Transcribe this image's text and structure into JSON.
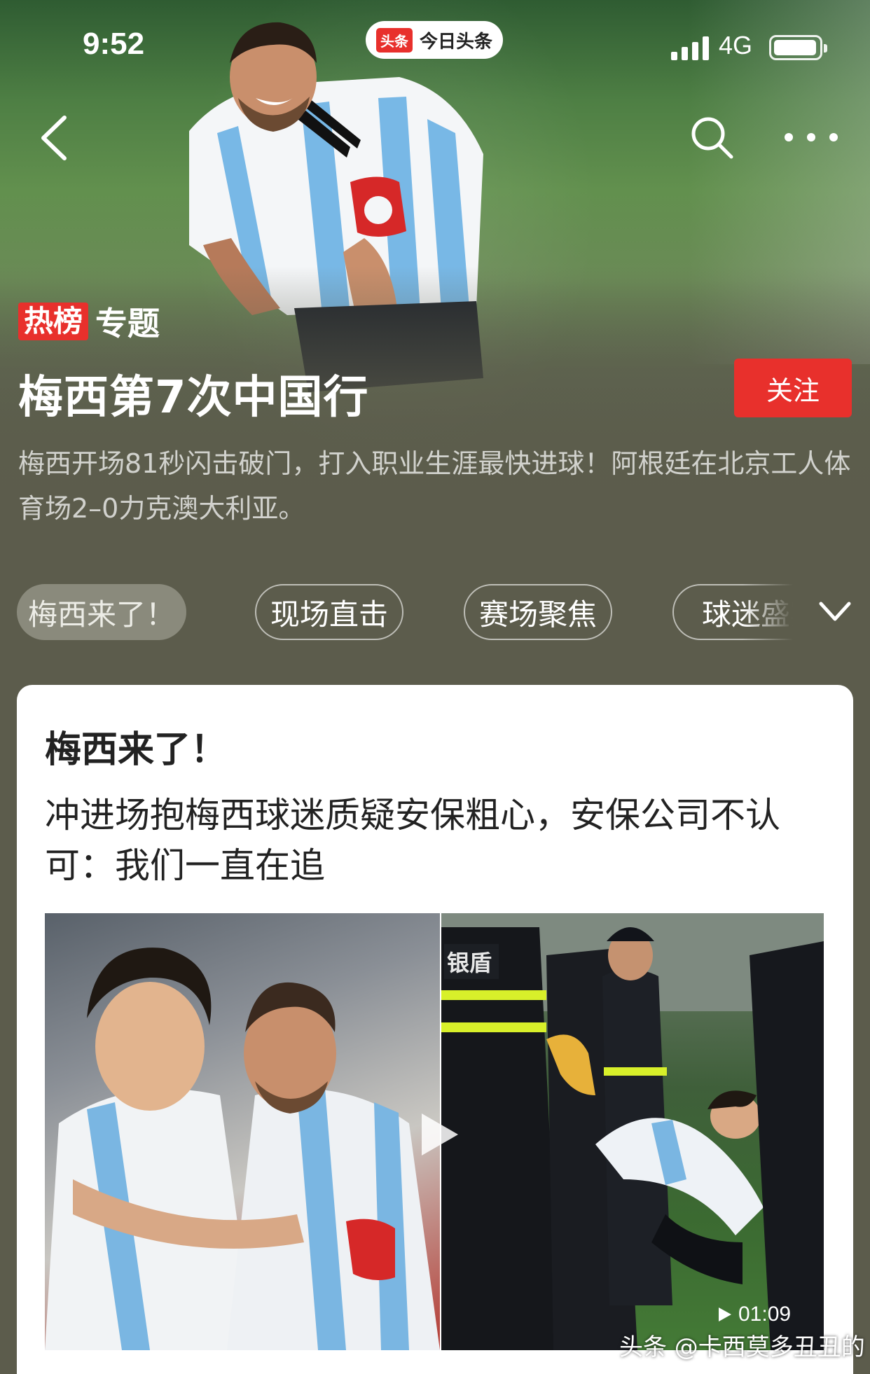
{
  "status_bar": {
    "time": "9:52",
    "app_logo": "头条",
    "app_name": "今日头条",
    "network": "4G"
  },
  "nav": {
    "back_icon": "chevron-left-icon",
    "search_icon": "search-icon",
    "more_icon": "more-dots-icon"
  },
  "topic": {
    "badge": "热榜",
    "label": "专题",
    "title": "梅西第7次中国行",
    "follow_label": "关注",
    "description": "梅西开场81秒闪击破门，打入职业生涯最快进球！阿根廷在北京工人体育场2–0力克澳大利亚。"
  },
  "tabs": [
    {
      "label": "梅西来了！",
      "active": true
    },
    {
      "label": "现场直击",
      "active": false
    },
    {
      "label": "赛场聚焦",
      "active": false
    },
    {
      "label": "球迷盛宴",
      "active": false
    }
  ],
  "card": {
    "heading": "梅西来了！",
    "article_title": "冲进场抱梅西球迷质疑安保粗心，安保公司不认可：我们一直在追",
    "video_duration": "01:09",
    "security_vest_text": "银盾"
  },
  "watermark": "头条 @卡西莫多丑丑的",
  "colors": {
    "accent_red": "#e8302c",
    "page_background": "#5c5c4c",
    "active_tab_bg": "#8a8a7c"
  }
}
